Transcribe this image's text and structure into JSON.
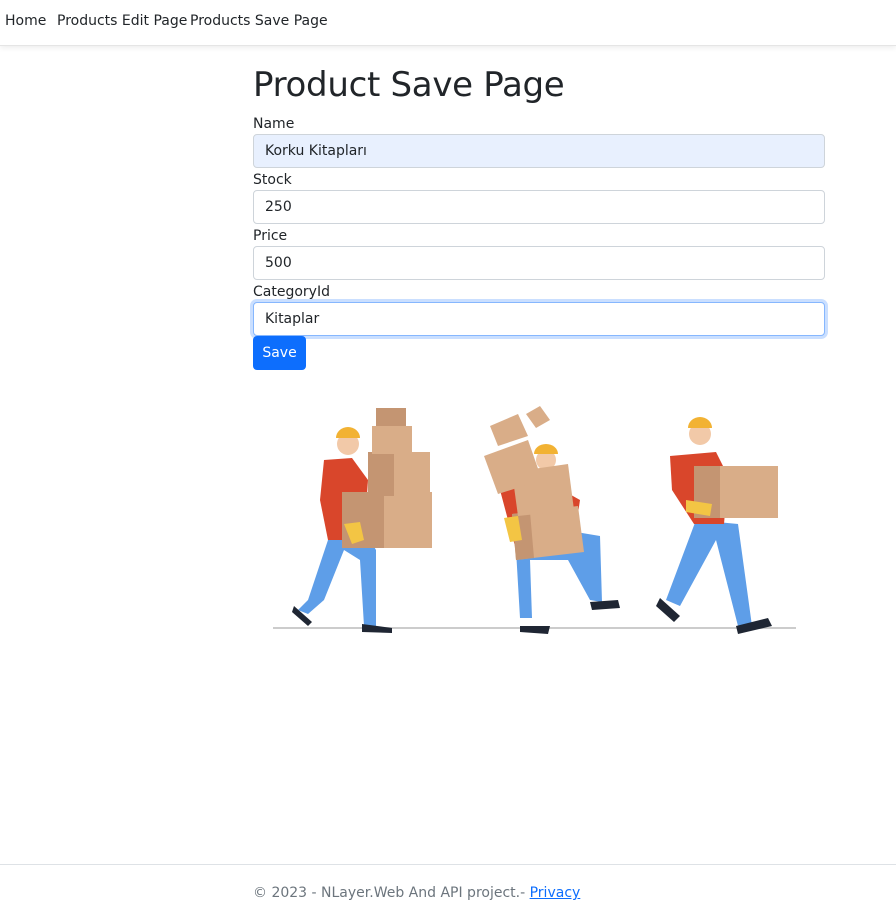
{
  "nav": {
    "items": [
      {
        "label": "Home"
      },
      {
        "label": "Products Edit Page"
      },
      {
        "label": "Products Save Page"
      }
    ]
  },
  "page": {
    "title": "Product Save Page"
  },
  "form": {
    "fields": [
      {
        "label": "Name",
        "value": "Korku Kitapları"
      },
      {
        "label": "Stock",
        "value": "250"
      },
      {
        "label": "Price",
        "value": "500"
      },
      {
        "label": "CategoryId",
        "value": "Kitaplar"
      }
    ],
    "save_label": "Save"
  },
  "illustration": {
    "name": "delivery-workers-carrying-boxes",
    "colors": {
      "skin": "#f2c9a8",
      "hair": "#2b2323",
      "helmet": "#f2b233",
      "shirt": "#d9462b",
      "pants": "#5e9ee8",
      "box": "#d9ad88",
      "box_shade": "#c49572",
      "glove": "#f3c544",
      "shoe": "#1f2633",
      "ground": "#cccccc"
    }
  },
  "footer": {
    "text": "© 2023 - NLayer.Web And API project.- ",
    "link": "Privacy"
  },
  "colors": {
    "primary": "#0d6efd",
    "autofill": "#e8f0fe",
    "focus_ring": "#86b7fe",
    "text": "#212529",
    "muted": "#6c757d"
  }
}
